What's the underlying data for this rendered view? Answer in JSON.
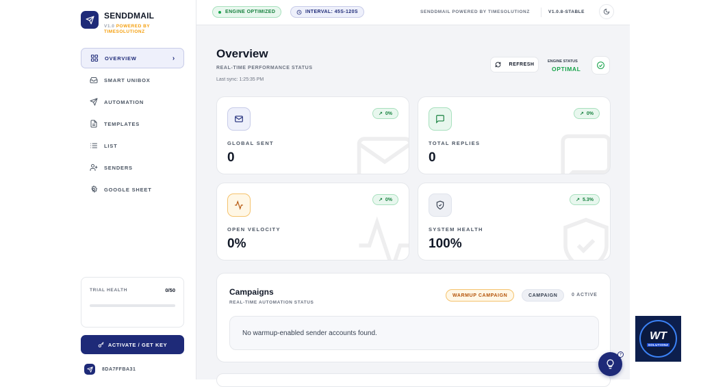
{
  "brand": {
    "name": "SENDDMAIL",
    "version": "V1.0",
    "powered_by": "POWERED BY TIMESOLUTIONZ"
  },
  "sidebar": {
    "items": [
      {
        "label": "OVERVIEW",
        "icon": "grid-icon",
        "active": true
      },
      {
        "label": "SMART UNIBOX",
        "icon": "inbox-icon"
      },
      {
        "label": "AUTOMATION",
        "icon": "send-icon"
      },
      {
        "label": "TEMPLATES",
        "icon": "file-icon"
      },
      {
        "label": "LIST",
        "icon": "list-icon"
      },
      {
        "label": "SENDERS",
        "icon": "user-plus-icon"
      },
      {
        "label": "GOOGLE SHEET",
        "icon": "gear-icon"
      }
    ],
    "trial": {
      "label": "TRIAL HEALTH",
      "value": "0/50",
      "progress": 0
    },
    "activate_label": "ACTIVATE / GET KEY",
    "user_id": "8DA7FFBA31"
  },
  "topbar": {
    "engine_pill": "ENGINE OPTIMIZED",
    "interval_pill": "INTERVAL: 45S-120S",
    "powered_by": "SENDDMAIL POWERED BY TIMESOLUTIONZ",
    "version": "V1.0.8-STABLE"
  },
  "overview": {
    "title": "Overview",
    "subtitle": "REAL-TIME PERFORMANCE STATUS",
    "last_sync": "Last sync: 1:25:35 PM",
    "refresh_label": "REFRESH",
    "engine_status_label": "ENGINE STATUS",
    "engine_status_value": "OPTIMAL"
  },
  "stats": [
    {
      "label": "GLOBAL SENT",
      "value": "0",
      "change": "0%",
      "icon": "mail-icon",
      "icon_bg": "#eef0fb",
      "icon_border": "#c7cbe8",
      "icon_color": "#1e2a78"
    },
    {
      "label": "TOTAL REPLIES",
      "value": "0",
      "change": "0%",
      "icon": "message-icon",
      "icon_bg": "#e8f7ee",
      "icon_border": "#a7e0bd",
      "icon_color": "#15803d"
    },
    {
      "label": "OPEN VELOCITY",
      "value": "0%",
      "change": "0%",
      "icon": "activity-icon",
      "icon_bg": "#fff7e6",
      "icon_border": "#f5c26b",
      "icon_color": "#b45309"
    },
    {
      "label": "SYSTEM HEALTH",
      "value": "100%",
      "change": "5.3%",
      "icon": "shield-check-icon",
      "icon_bg": "#eef0f5",
      "icon_border": "#dfe3ec",
      "icon_color": "#374151"
    }
  ],
  "campaigns": {
    "title": "Campaigns",
    "subtitle": "REAL-TIME AUTOMATION STATUS",
    "warmup_label": "WARMUP CAMPAIGN",
    "campaign_label": "CAMPAIGN",
    "active_count": "0 ACTIVE",
    "empty_message": "No warmup-enabled sender accounts found."
  },
  "help": {
    "badge": "?"
  },
  "watermark_logo": {
    "letters": "WT",
    "sub": "SOLUTIONZ"
  },
  "colors": {
    "primary": "#1e2a78",
    "success": "#16a34a",
    "warning": "#f59e0b"
  }
}
